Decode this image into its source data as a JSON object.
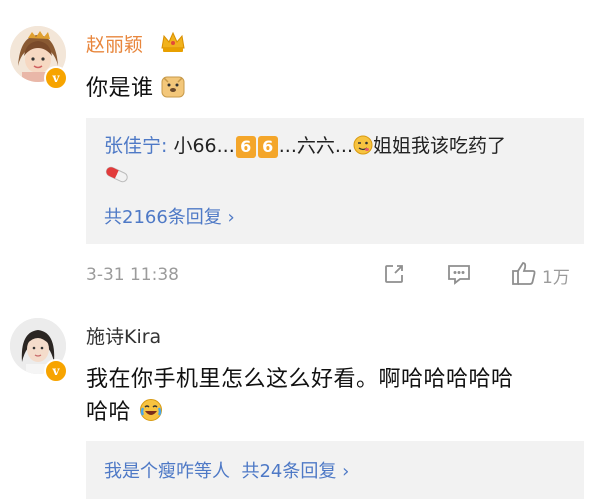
{
  "comment1": {
    "username": "赵丽颖",
    "text": "你是谁",
    "reply": {
      "author": "张佳宁:",
      "text_a": " 小66...",
      "box1": "6",
      "box2": "6",
      "text_b": "...六六...",
      "text_c": "姐姐我该吃药了",
      "count_link": "共2166条回复 ›"
    },
    "timestamp": "3-31 11:38",
    "like_count": "1万"
  },
  "comment2": {
    "username": "施诗Kira",
    "text_line1": "我在你手机里怎么这么好看。啊哈哈哈哈哈",
    "text_line2": "哈哈",
    "reply_preview": "我是个瘦咋等人  共24条回复 ›"
  },
  "colors": {
    "username_highlight": "#e8863c",
    "link": "#4e79c6",
    "verified_badge": "#f7a400"
  },
  "icons": [
    "crown-icon",
    "verified-badge-icon",
    "doge-emoji-icon",
    "wink-emoji-icon",
    "pill-emoji-icon",
    "share-icon",
    "comment-icon",
    "like-icon",
    "laugh-cry-emoji-icon"
  ]
}
